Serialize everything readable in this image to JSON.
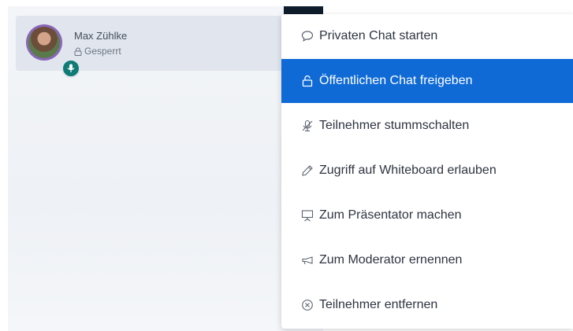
{
  "user": {
    "name": "Max Zühlke",
    "status_label": "Gesperrt",
    "status_icon": "lock-icon",
    "badge_icon": "microphone-icon"
  },
  "menu": {
    "items": [
      {
        "label": "Privaten Chat starten",
        "icon": "chat-bubble-icon",
        "active": false
      },
      {
        "label": "Öffentlichen Chat freigeben",
        "icon": "unlock-icon",
        "active": true
      },
      {
        "label": "Teilnehmer stummschalten",
        "icon": "microphone-muted-icon",
        "active": false
      },
      {
        "label": "Zugriff auf Whiteboard erlauben",
        "icon": "pencil-icon",
        "active": false
      },
      {
        "label": "Zum Präsentator machen",
        "icon": "presentation-icon",
        "active": false
      },
      {
        "label": "Zum Moderator ernennen",
        "icon": "megaphone-icon",
        "active": false
      },
      {
        "label": "Teilnehmer entfernen",
        "icon": "remove-circle-icon",
        "active": false
      }
    ]
  },
  "colors": {
    "active_bg": "#0f6ad6",
    "badge_bg": "#0f7b75",
    "avatar_ring": "#8a66b8"
  }
}
